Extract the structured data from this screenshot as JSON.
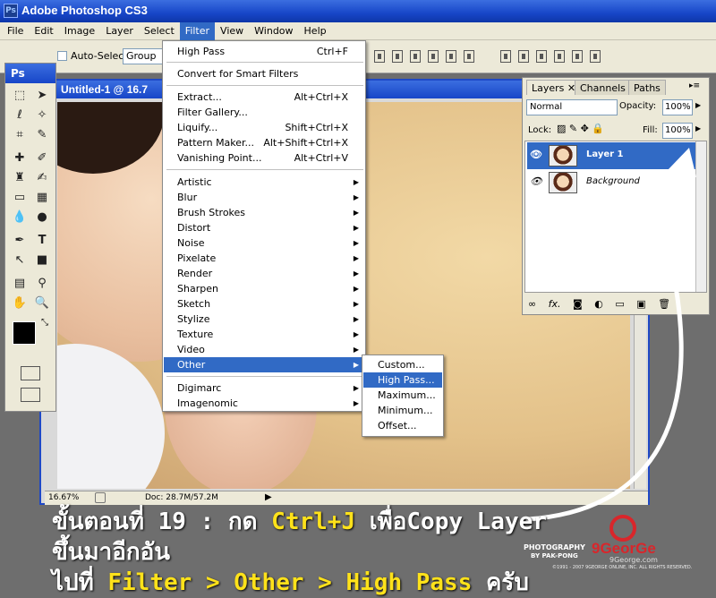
{
  "app": {
    "title": "Adobe Photoshop CS3",
    "logo": "Ps"
  },
  "menubar": {
    "items": [
      "File",
      "Edit",
      "Image",
      "Layer",
      "Select",
      "Filter",
      "View",
      "Window",
      "Help"
    ],
    "active": "Filter"
  },
  "options": {
    "auto_select_label": "Auto-Select:",
    "auto_select_value": "Group"
  },
  "document": {
    "title": "Untitled-1 @ 16.7",
    "zoom": "16.67%",
    "doc_size": "Doc: 28.7M/57.2M"
  },
  "filter_menu": {
    "items": [
      {
        "label": "High Pass",
        "shortcut": "Ctrl+F"
      },
      {
        "label": "Convert for Smart Filters",
        "shortcut": ""
      },
      {
        "label": "Extract...",
        "shortcut": "Alt+Ctrl+X"
      },
      {
        "label": "Filter Gallery...",
        "shortcut": ""
      },
      {
        "label": "Liquify...",
        "shortcut": "Shift+Ctrl+X"
      },
      {
        "label": "Pattern Maker...",
        "shortcut": "Alt+Shift+Ctrl+X"
      },
      {
        "label": "Vanishing Point...",
        "shortcut": "Alt+Ctrl+V"
      },
      {
        "label": "Artistic",
        "shortcut": ""
      },
      {
        "label": "Blur",
        "shortcut": ""
      },
      {
        "label": "Brush Strokes",
        "shortcut": ""
      },
      {
        "label": "Distort",
        "shortcut": ""
      },
      {
        "label": "Noise",
        "shortcut": ""
      },
      {
        "label": "Pixelate",
        "shortcut": ""
      },
      {
        "label": "Render",
        "shortcut": ""
      },
      {
        "label": "Sharpen",
        "shortcut": ""
      },
      {
        "label": "Sketch",
        "shortcut": ""
      },
      {
        "label": "Stylize",
        "shortcut": ""
      },
      {
        "label": "Texture",
        "shortcut": ""
      },
      {
        "label": "Video",
        "shortcut": ""
      },
      {
        "label": "Other",
        "shortcut": ""
      },
      {
        "label": "Digimarc",
        "shortcut": ""
      },
      {
        "label": "Imagenomic",
        "shortcut": ""
      }
    ]
  },
  "other_submenu": {
    "items": [
      "Custom...",
      "High Pass...",
      "Maximum...",
      "Minimum...",
      "Offset..."
    ],
    "selected": "High Pass..."
  },
  "layers_panel": {
    "tabs": [
      "Layers",
      "Channels",
      "Paths"
    ],
    "blend_mode": "Normal",
    "opacity_label": "Opacity:",
    "opacity": "100%",
    "lock_label": "Lock:",
    "fill_label": "Fill:",
    "fill": "100%",
    "layers": [
      {
        "name": "Layer 1",
        "selected": true
      },
      {
        "name": "Background",
        "selected": false
      }
    ]
  },
  "caption": {
    "line1_prefix": "ขั้นตอนที่ 19 : กด ",
    "line1_key": "Ctrl+J",
    "line1_suffix": " เพื่อCopy Layer ขึ้นมาอีกอัน",
    "line2_prefix": "ไปที่ ",
    "line2_path": "Filter > Other > High Pass",
    "line2_suffix": " ครับ"
  },
  "watermark": {
    "photography": "PHOTOGRAPHY",
    "by": "BY PAK-PONG",
    "brand": "9GeorGe",
    "sub": "9George.com",
    "copyright": "©1991 - 2007 9GEORGE ONLINE, INC. ALL RIGHTS RESERVED."
  },
  "colors": {
    "title_blue": "#1746c8",
    "menu_highlight": "#316ac5",
    "caption_yellow": "#ffe21a"
  }
}
